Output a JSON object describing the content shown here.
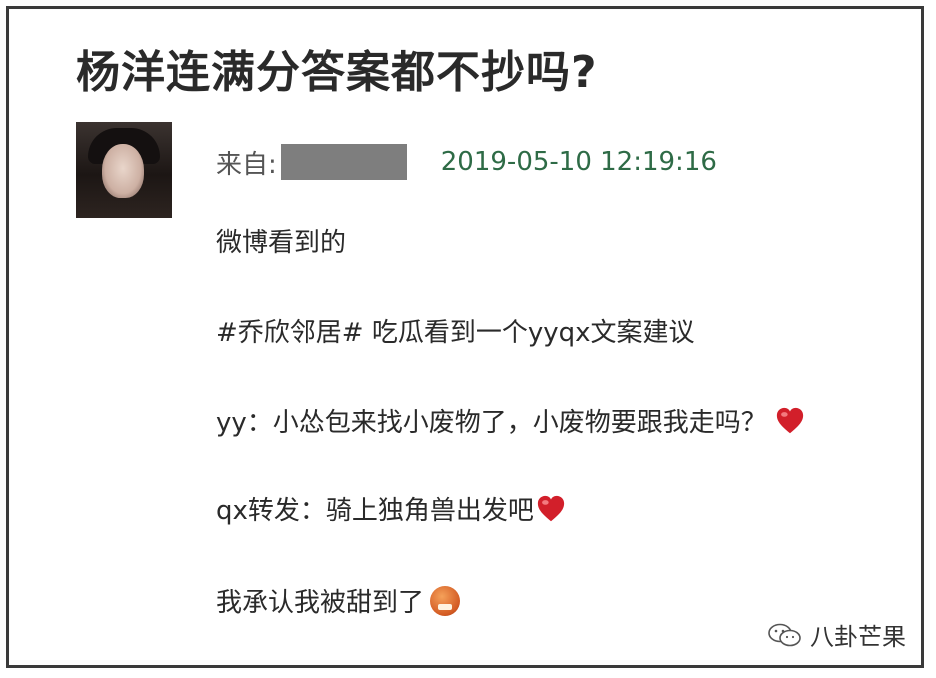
{
  "post": {
    "title": "杨洋连满分答案都不抄吗?",
    "from_label": "来自:",
    "timestamp": "2019-05-10 12:19:16",
    "lines": [
      "微博看到的",
      "#乔欣邻居# 吃瓜看到一个yyqx文案建议",
      "yy：小怂包来找小废物了，小废物要跟我走吗？",
      "qx转发：骑上独角兽出发吧",
      "我承认我被甜到了"
    ]
  },
  "icons": {
    "heart": "red-heart-icon",
    "face": "emoji-face-icon",
    "wechat": "wechat-icon"
  },
  "watermark": {
    "text": "八卦芒果"
  },
  "colors": {
    "timestamp": "#2e6b46",
    "redaction": "#7e7e7e",
    "heart": "#d21f2a"
  }
}
